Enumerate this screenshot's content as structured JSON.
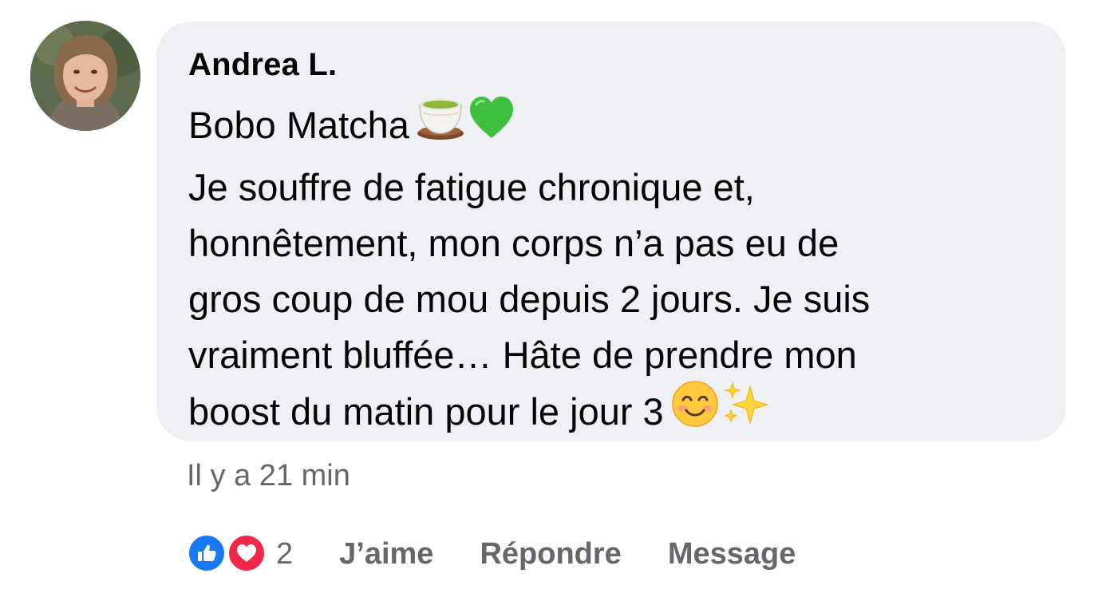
{
  "comment": {
    "author": "Andrea L.",
    "lines": [
      "Bobo Matcha",
      "Je souffre de fatigue chronique et,",
      "honnêtement, mon corps n’a pas eu de",
      "gros coup de mou depuis 2 jours. Je suis",
      "vraiment bluffée… Hâte de prendre mon",
      "boost du matin pour le jour 3"
    ],
    "timestamp": "Il y a 21 min",
    "reaction_count": "2",
    "actions": {
      "like_label": "J’aime",
      "reply_label": "Répondre",
      "message_label": "Message"
    },
    "icons": {
      "line1_emojis": [
        "teacup-icon",
        "green-heart-icon"
      ],
      "line6_emojis": [
        "smiling-face-icon",
        "sparkles-icon"
      ],
      "reactions": [
        "like-reaction-icon",
        "love-reaction-icon"
      ]
    }
  },
  "colors": {
    "bubble": "#eef0f3",
    "text": "#050505",
    "muted": "#65676b",
    "like_blue": "#1877f2",
    "love_red": "#f02849"
  }
}
